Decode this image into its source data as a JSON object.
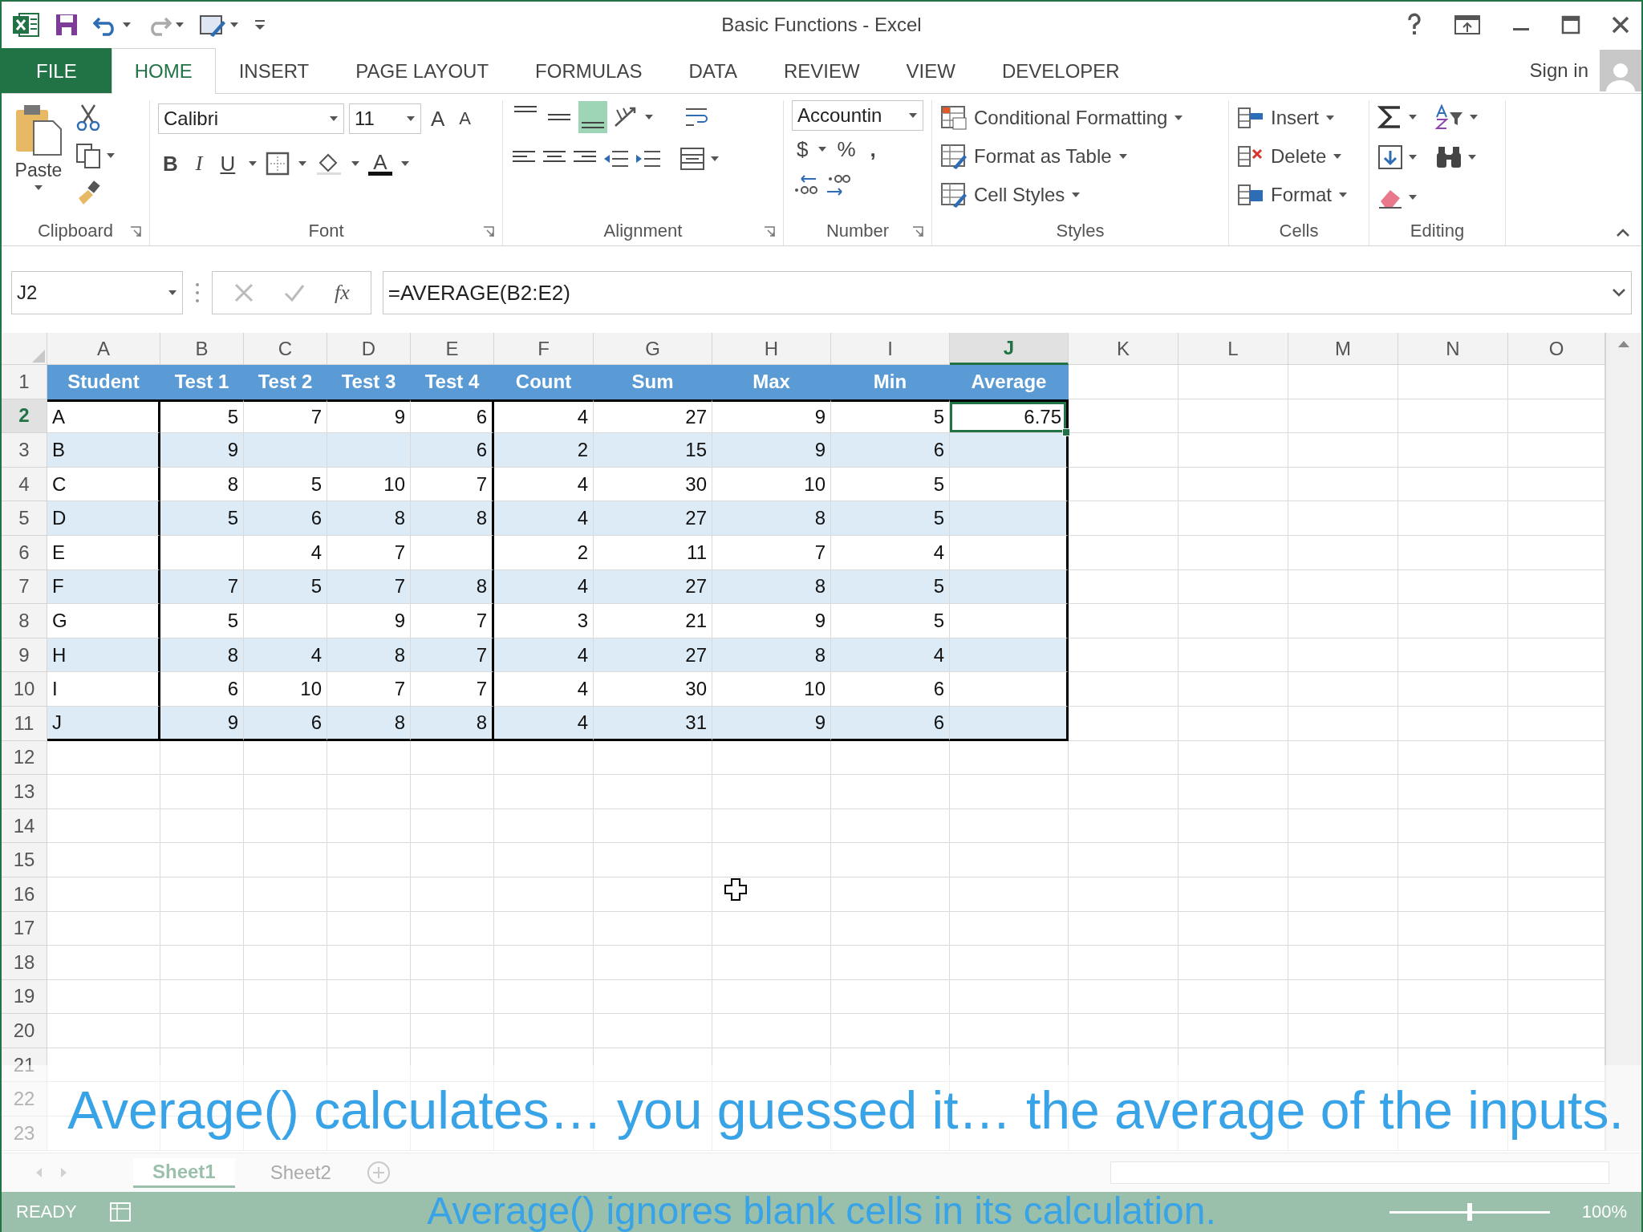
{
  "window": {
    "title": "Basic Functions - Excel"
  },
  "ribbon_tabs": [
    {
      "label": "FILE",
      "kind": "file",
      "selected": false
    },
    {
      "label": "HOME",
      "kind": "tab",
      "selected": true
    },
    {
      "label": "INSERT",
      "kind": "tab",
      "selected": false
    },
    {
      "label": "PAGE LAYOUT",
      "kind": "tab",
      "selected": false
    },
    {
      "label": "FORMULAS",
      "kind": "tab",
      "selected": false
    },
    {
      "label": "DATA",
      "kind": "tab",
      "selected": false
    },
    {
      "label": "REVIEW",
      "kind": "tab",
      "selected": false
    },
    {
      "label": "VIEW",
      "kind": "tab",
      "selected": false
    },
    {
      "label": "DEVELOPER",
      "kind": "tab",
      "selected": false
    }
  ],
  "account": {
    "label": "Sign in"
  },
  "clipboard": {
    "paste": "Paste",
    "label": "Clipboard"
  },
  "font": {
    "name": "Calibri",
    "size": "11",
    "grow": "A",
    "shrink": "A",
    "bold": "B",
    "italic": "I",
    "underline": "U",
    "color_button": "A",
    "label": "Font"
  },
  "alignment": {
    "vertical": [
      {
        "selected": false
      },
      {
        "selected": false
      },
      {
        "selected": true
      }
    ],
    "label": "Alignment"
  },
  "number": {
    "format": "Accountin",
    "currency": "$",
    "percent": "%",
    "comma": ",",
    "label": "Number"
  },
  "styles": {
    "items": [
      "Conditional Formatting",
      "Format as Table",
      "Cell Styles"
    ],
    "label": "Styles"
  },
  "cells": {
    "items": [
      "Insert",
      "Delete",
      "Format"
    ],
    "label": "Cells"
  },
  "editing": {
    "label": "Editing"
  },
  "formula_bar": {
    "name_box": "J2",
    "fx": "fx",
    "formula": "=AVERAGE(B2:E2)"
  },
  "sheet": {
    "columns": [
      {
        "label": "A",
        "selected": false
      },
      {
        "label": "B",
        "selected": false
      },
      {
        "label": "C",
        "selected": false
      },
      {
        "label": "D",
        "selected": false
      },
      {
        "label": "E",
        "selected": false
      },
      {
        "label": "F",
        "selected": false
      },
      {
        "label": "G",
        "selected": false
      },
      {
        "label": "H",
        "selected": false
      },
      {
        "label": "I",
        "selected": false
      },
      {
        "label": "J",
        "selected": true
      },
      {
        "label": "K",
        "selected": false
      },
      {
        "label": "L",
        "selected": false
      },
      {
        "label": "M",
        "selected": false
      },
      {
        "label": "N",
        "selected": false
      },
      {
        "label": "O",
        "selected": false
      }
    ],
    "rows": [
      {
        "number": "1",
        "kind": "header",
        "selected": false,
        "cells": [
          "Student",
          "Test 1",
          "Test 2",
          "Test 3",
          "Test 4",
          "Count",
          "Sum",
          "Max",
          "Min",
          "Average"
        ]
      },
      {
        "number": "2",
        "kind": "data",
        "banded": false,
        "selected": true,
        "cells": [
          "A",
          "5",
          "7",
          "9",
          "6",
          "4",
          "27",
          "9",
          "5",
          "6.75"
        ]
      },
      {
        "number": "3",
        "kind": "data",
        "banded": true,
        "selected": false,
        "cells": [
          "B",
          "9",
          null,
          null,
          "6",
          "2",
          "15",
          "9",
          "6",
          null
        ]
      },
      {
        "number": "4",
        "kind": "data",
        "banded": false,
        "selected": false,
        "cells": [
          "C",
          "8",
          "5",
          "10",
          "7",
          "4",
          "30",
          "10",
          "5",
          null
        ]
      },
      {
        "number": "5",
        "kind": "data",
        "banded": true,
        "selected": false,
        "cells": [
          "D",
          "5",
          "6",
          "8",
          "8",
          "4",
          "27",
          "8",
          "5",
          null
        ]
      },
      {
        "number": "6",
        "kind": "data",
        "banded": false,
        "selected": false,
        "cells": [
          "E",
          null,
          "4",
          "7",
          null,
          "2",
          "11",
          "7",
          "4",
          null
        ]
      },
      {
        "number": "7",
        "kind": "data",
        "banded": true,
        "selected": false,
        "cells": [
          "F",
          "7",
          "5",
          "7",
          "8",
          "4",
          "27",
          "8",
          "5",
          null
        ]
      },
      {
        "number": "8",
        "kind": "data",
        "banded": false,
        "selected": false,
        "cells": [
          "G",
          "5",
          null,
          "9",
          "7",
          "3",
          "21",
          "9",
          "5",
          null
        ]
      },
      {
        "number": "9",
        "kind": "data",
        "banded": true,
        "selected": false,
        "cells": [
          "H",
          "8",
          "4",
          "8",
          "7",
          "4",
          "27",
          "8",
          "4",
          null
        ]
      },
      {
        "number": "10",
        "kind": "data",
        "banded": false,
        "selected": false,
        "cells": [
          "I",
          "6",
          "10",
          "7",
          "7",
          "4",
          "30",
          "10",
          "6",
          null
        ]
      },
      {
        "number": "11",
        "kind": "data",
        "banded": true,
        "selected": false,
        "cells": [
          "J",
          "9",
          "6",
          "8",
          "8",
          "4",
          "31",
          "9",
          "6",
          null
        ]
      },
      {
        "number": "12",
        "kind": "empty",
        "selected": false
      },
      {
        "number": "13",
        "kind": "empty",
        "selected": false
      },
      {
        "number": "14",
        "kind": "empty",
        "selected": false
      },
      {
        "number": "15",
        "kind": "empty",
        "selected": false
      },
      {
        "number": "16",
        "kind": "empty",
        "selected": false
      },
      {
        "number": "17",
        "kind": "empty",
        "selected": false
      },
      {
        "number": "18",
        "kind": "empty",
        "selected": false
      },
      {
        "number": "19",
        "kind": "empty",
        "selected": false
      },
      {
        "number": "20",
        "kind": "empty",
        "selected": false
      },
      {
        "number": "21",
        "kind": "empty",
        "selected": false
      },
      {
        "number": "22",
        "kind": "empty",
        "selected": false
      },
      {
        "number": "23",
        "kind": "empty",
        "selected": false
      }
    ]
  },
  "sheet_tabs": [
    {
      "label": "Sheet1",
      "selected": true
    },
    {
      "label": "Sheet2",
      "selected": false
    }
  ],
  "status_bar": {
    "mode": "READY",
    "zoom_slider": {
      "level": 0.5
    },
    "zoom": "100%"
  },
  "captions": [
    "Average() calculates… you guessed it… the average of the inputs.",
    "Average() ignores blank cells in its calculation."
  ]
}
